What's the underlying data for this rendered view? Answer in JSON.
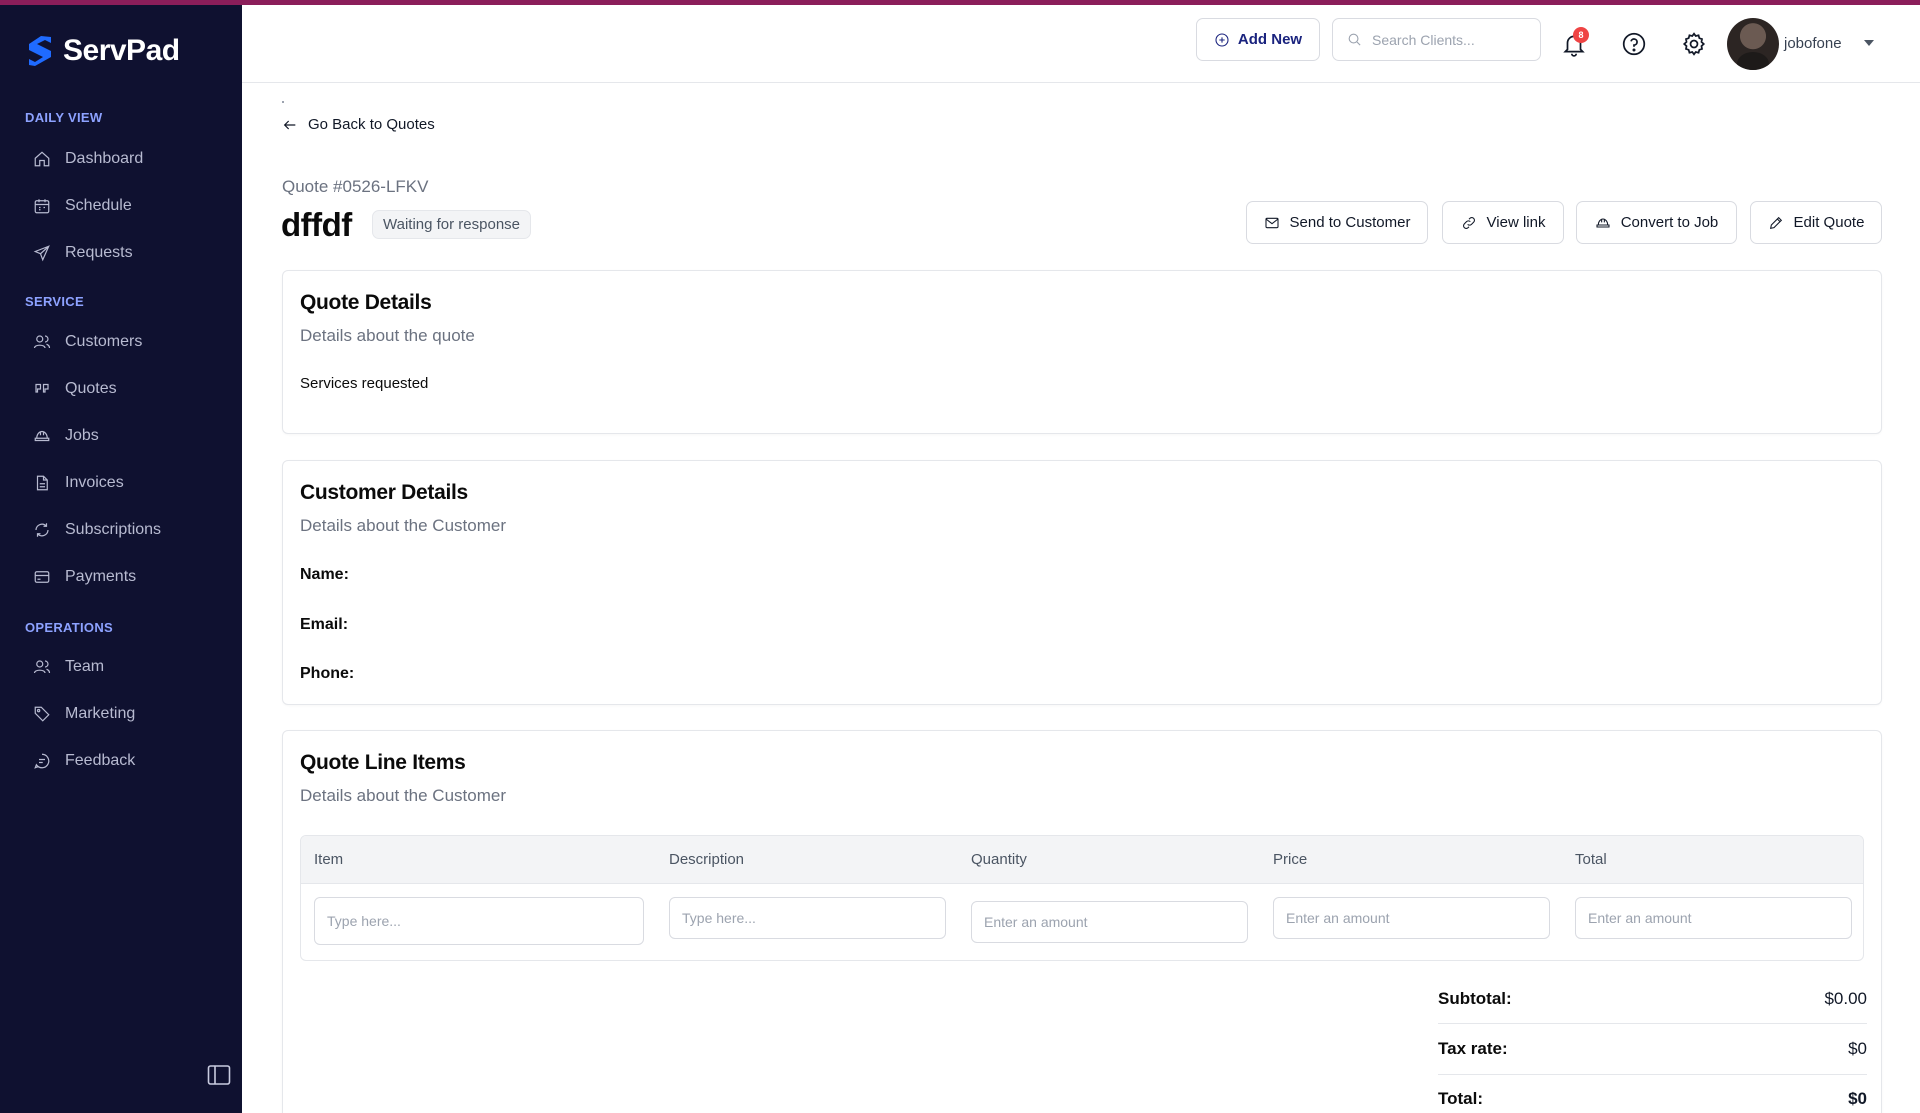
{
  "app": {
    "name": "ServPad"
  },
  "colors": {
    "sidebar_bg": "#0f1130",
    "accent": "#1a237e",
    "section_heading": "#8da2ff",
    "badge": "#ef4444"
  },
  "sidebar": {
    "sections": [
      {
        "heading": "DAILY VIEW",
        "items": [
          {
            "label": "Dashboard",
            "icon": "home-icon"
          },
          {
            "label": "Schedule",
            "icon": "calendar-icon"
          },
          {
            "label": "Requests",
            "icon": "send-icon"
          }
        ]
      },
      {
        "heading": "SERVICE",
        "items": [
          {
            "label": "Customers",
            "icon": "users-icon"
          },
          {
            "label": "Quotes",
            "icon": "quote-icon"
          },
          {
            "label": "Jobs",
            "icon": "hardhat-icon"
          },
          {
            "label": "Invoices",
            "icon": "file-icon"
          },
          {
            "label": "Subscriptions",
            "icon": "refresh-icon"
          },
          {
            "label": "Payments",
            "icon": "card-icon"
          }
        ]
      },
      {
        "heading": "OPERATIONS",
        "items": [
          {
            "label": "Team",
            "icon": "users-icon"
          },
          {
            "label": "Marketing",
            "icon": "tag-icon"
          },
          {
            "label": "Feedback",
            "icon": "chat-icon"
          }
        ]
      }
    ]
  },
  "header": {
    "add_new": "Add New",
    "search_placeholder": "Search Clients...",
    "notification_count": "8",
    "username": "jobofone"
  },
  "page": {
    "back_label": "Go Back to Quotes",
    "quote_number": "Quote #0526-LFKV",
    "title": "dffdf",
    "status": "Waiting for response",
    "actions": {
      "send": "Send to Customer",
      "view_link": "View link",
      "convert": "Convert to Job",
      "edit": "Edit Quote"
    }
  },
  "quote_details": {
    "title": "Quote Details",
    "subtitle": "Details about the quote",
    "services_label": "Services requested"
  },
  "customer_details": {
    "title": "Customer Details",
    "subtitle": "Details about the Customer",
    "name_label": "Name:",
    "email_label": "Email:",
    "phone_label": "Phone:"
  },
  "line_items": {
    "title": "Quote Line Items",
    "subtitle": "Details about the Customer",
    "columns": [
      "Item",
      "Description",
      "Quantity",
      "Price",
      "Total"
    ],
    "placeholders": {
      "item": "Type here...",
      "description": "Type here...",
      "quantity": "Enter an amount",
      "price": "Enter an amount",
      "total": "Enter an amount"
    }
  },
  "summary": {
    "subtotal_label": "Subtotal:",
    "subtotal_value": "$0.00",
    "tax_label": "Tax rate:",
    "tax_value": "$0",
    "total_label": "Total:",
    "total_value": "$0"
  }
}
